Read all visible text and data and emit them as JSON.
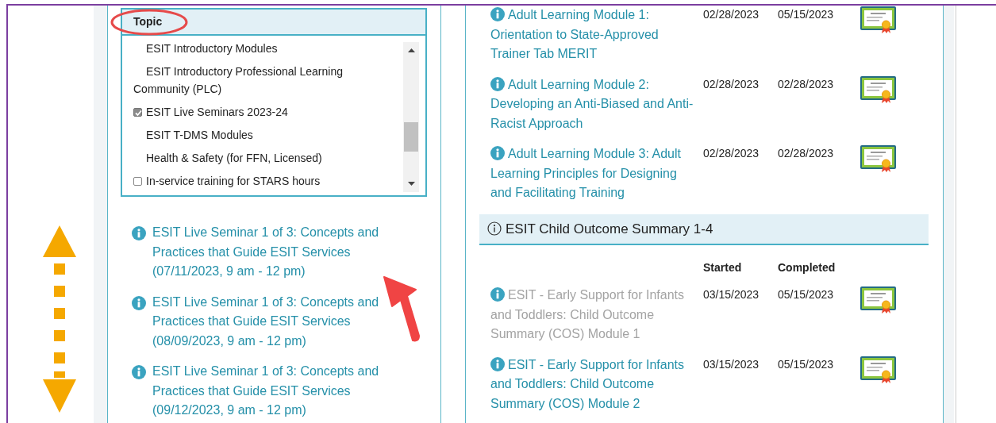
{
  "topic_filter": {
    "header": "Topic",
    "items": [
      {
        "kind": "plain",
        "label": "ESIT Introductory Modules"
      },
      {
        "kind": "plain",
        "label": "ESIT Introductory Professional Learning Community (PLC)"
      },
      {
        "kind": "checkbox",
        "label": "ESIT Live Seminars 2023-24",
        "checked": true
      },
      {
        "kind": "plain",
        "label": "ESIT T-DMS Modules"
      },
      {
        "kind": "plain",
        "label": "Health & Safety (for FFN, Licensed)"
      },
      {
        "kind": "checkbox",
        "label": "In-service training for STARS hours",
        "checked": false
      }
    ]
  },
  "seminars": [
    {
      "title": "ESIT Live Seminar 1 of 3: Concepts and Practices that Guide ESIT Services (07/11/2023, 9 am - 12 pm)"
    },
    {
      "title": "ESIT Live Seminar 1 of 3: Concepts and Practices that Guide ESIT Services (08/09/2023, 9 am - 12 pm)"
    },
    {
      "title": "ESIT Live Seminar 1 of 3: Concepts and Practices that Guide ESIT Services (09/12/2023, 9 am - 12 pm)"
    }
  ],
  "course_groups": [
    {
      "courses": [
        {
          "title": "Adult Learning Module 1: Orientation to State-Approved Trainer Tab MERIT",
          "started": "02/28/2023",
          "completed": "05/15/2023",
          "disabled": false
        },
        {
          "title": "Adult Learning Module 2: Developing an Anti-Biased and Anti-Racist Approach",
          "started": "02/28/2023",
          "completed": "02/28/2023",
          "disabled": false
        },
        {
          "title": "Adult Learning Module 3: Adult Learning Principles for Designing and Facilitating Training",
          "started": "02/28/2023",
          "completed": "02/28/2023",
          "disabled": false
        }
      ]
    },
    {
      "title": "ESIT Child Outcome Summary 1-4",
      "columns": [
        "Started",
        "Completed"
      ],
      "courses": [
        {
          "title": "ESIT - Early Support for Infants and Toddlers: Child Outcome Summary (COS) Module 1",
          "started": "03/15/2023",
          "completed": "05/15/2023",
          "disabled": true
        },
        {
          "title": "ESIT - Early Support for Infants and Toddlers: Child Outcome Summary (COS) Module 2",
          "started": "03/15/2023",
          "completed": "05/15/2023",
          "disabled": false
        }
      ]
    }
  ]
}
